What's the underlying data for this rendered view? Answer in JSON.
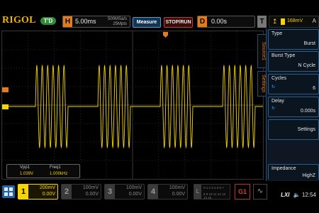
{
  "brand": {
    "name": "RIGOL",
    "run_state": "T'D"
  },
  "timebase": {
    "badge": "H",
    "value": "5.00ms",
    "sample_rate": "500MSa/s",
    "memory_depth": "25Mpts"
  },
  "buttons": {
    "measure": "Measure",
    "stop_run": "STOP/RUN"
  },
  "delay": {
    "badge": "D",
    "value": "0.00s"
  },
  "trigger": {
    "badge": "T",
    "level": "168mV",
    "mode": "A"
  },
  "side_tabs": {
    "source": "Source1",
    "settings": "Settings"
  },
  "menu": {
    "type": {
      "title": "Type",
      "value": "Burst"
    },
    "burst_type": {
      "title": "Burst Type",
      "value": "N Cycle"
    },
    "cycles": {
      "title": "Cycles",
      "value": "6"
    },
    "delay": {
      "title": "Delay",
      "value": "0.000s"
    },
    "settings": {
      "value": "Settings"
    },
    "impedance": {
      "title": "Impedance",
      "value": "HighZ"
    }
  },
  "measurements": {
    "vpp": {
      "label": "Vpp1",
      "value": "1.039V"
    },
    "freq": {
      "label": "Freq1",
      "value": "1.000kHz"
    }
  },
  "channels": [
    {
      "num": "1",
      "scale": "200mV",
      "offset": "0.00V",
      "active": true
    },
    {
      "num": "2",
      "scale": "100mV",
      "offset": "0.00V",
      "active": false
    },
    {
      "num": "3",
      "scale": "100mV",
      "offset": "0.00V",
      "active": false
    },
    {
      "num": "4",
      "scale": "100mV",
      "offset": "0.00V",
      "active": false
    }
  ],
  "logic": {
    "label": "L",
    "row1": "0 1 2 3  4 5 6 7",
    "row2": "8 9 10 11 12 13 14 15"
  },
  "generator": {
    "label": "G1"
  },
  "status": {
    "lxi": "LXI",
    "time": "12:54"
  },
  "colors": {
    "ch1": "#f5d400",
    "accent": "#e57a1a",
    "menu_border": "#2a5d8c"
  },
  "waveform": {
    "signal": "sine burst",
    "bursts": 4,
    "cycles_per_burst": 6,
    "amplitude_divisions": 2.6
  }
}
